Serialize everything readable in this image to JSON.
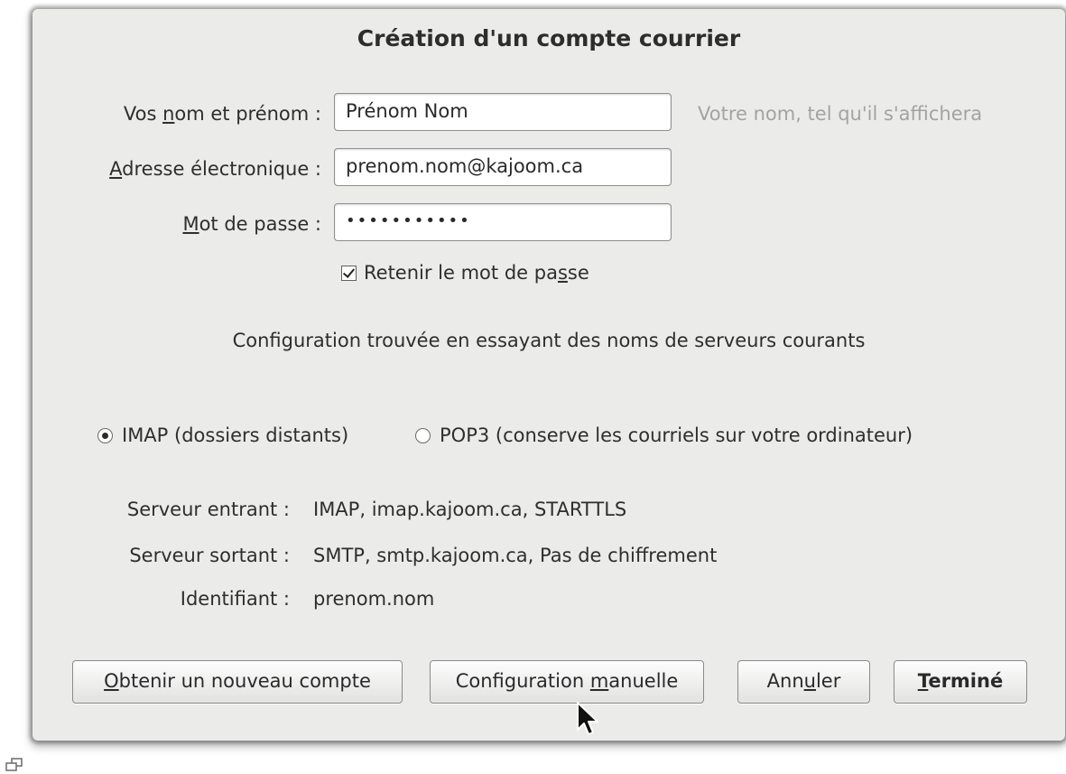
{
  "dialog": {
    "title": "Création d'un compte courrier"
  },
  "form": {
    "name": {
      "label_pre": "Vos ",
      "label_accel": "n",
      "label_post": "om et prénom :",
      "value": "Prénom Nom",
      "hint": "Votre nom, tel qu'il s'affichera"
    },
    "email": {
      "label_accel": "A",
      "label_post": "dresse électronique :",
      "value": "prenom.nom@kajoom.ca"
    },
    "password": {
      "label_accel": "M",
      "label_post": "ot de passe :",
      "value": "•••••••••••"
    },
    "remember": {
      "label_pre": "Retenir le mot de pa",
      "label_accel": "s",
      "label_post": "se",
      "checked": true
    }
  },
  "status": {
    "message": "Configuration trouvée en essayant des noms de serveurs courants"
  },
  "protocol": {
    "imap_label": "IMAP (dossiers distants)",
    "pop3_label": "POP3 (conserve les courriels sur votre ordinateur)",
    "selected": "IMAP"
  },
  "servers": {
    "incoming_label": "Serveur entrant :",
    "incoming_value": "IMAP, imap.kajoom.ca, STARTTLS",
    "outgoing_label": "Serveur sortant :",
    "outgoing_value": "SMTP, smtp.kajoom.ca, Pas de chiffrement",
    "username_label": "Identifiant :",
    "username_value": "prenom.nom"
  },
  "buttons": {
    "new_account": {
      "accel": "O",
      "post": "btenir un nouveau compte"
    },
    "manual_config": {
      "pre": "Configuration ",
      "accel": "m",
      "post": "anuelle"
    },
    "cancel": {
      "pre": "Ann",
      "accel": "u",
      "post": "ler"
    },
    "done": {
      "accel": "T",
      "post": "erminé"
    }
  },
  "icons": {
    "cursor": "mouse-pointer-icon",
    "restore": "window-restore-icon"
  }
}
